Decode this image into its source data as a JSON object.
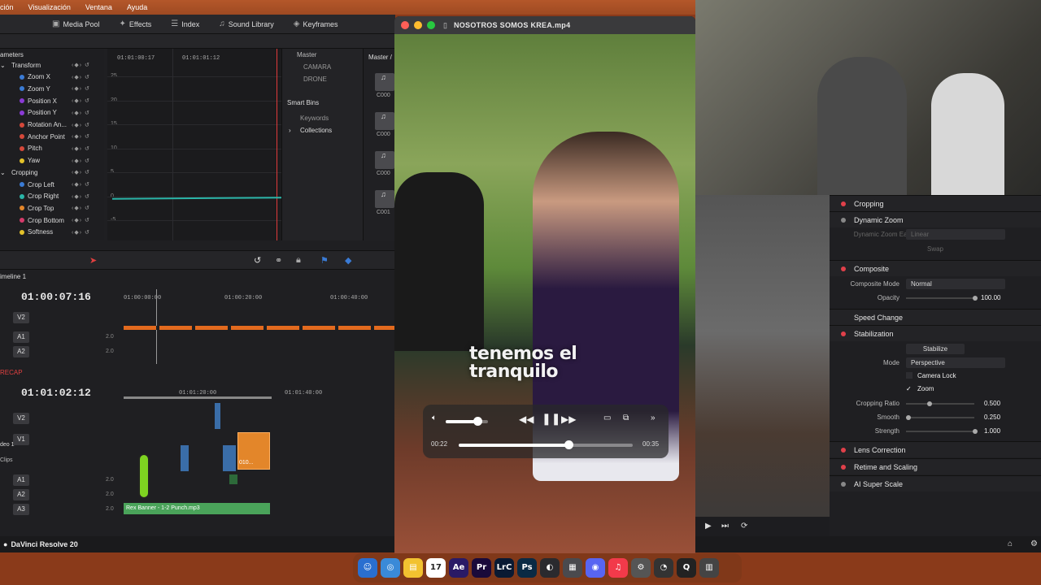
{
  "menubar": {
    "items": [
      "ción",
      "Visualización",
      "Ventana",
      "Ayuda"
    ]
  },
  "toolbar": {
    "media_pool": "Media Pool",
    "effects": "Effects",
    "index": "Index",
    "sound_library": "Sound Library",
    "keyframes": "Keyframes"
  },
  "keyframes": {
    "header": "ameters",
    "master_label": "Master",
    "params": [
      {
        "label": "Transform",
        "color": "#c0c0c0",
        "group": true
      },
      {
        "label": "Zoom X",
        "color": "#3a7bd5"
      },
      {
        "label": "Zoom Y",
        "color": "#3a7bd5"
      },
      {
        "label": "Position X",
        "color": "#8a3ad5"
      },
      {
        "label": "Position Y",
        "color": "#8a3ad5"
      },
      {
        "label": "Rotation An...",
        "color": "#d5483a"
      },
      {
        "label": "Anchor Point",
        "color": "#d5483a"
      },
      {
        "label": "Pitch",
        "color": "#d5483a"
      },
      {
        "label": "Yaw",
        "color": "#e3c22a"
      },
      {
        "label": "Cropping",
        "color": "#c0c0c0",
        "group": true
      },
      {
        "label": "Crop Left",
        "color": "#3a7bd5"
      },
      {
        "label": "Crop Right",
        "color": "#2ab5a8"
      },
      {
        "label": "Crop Top",
        "color": "#e3862a"
      },
      {
        "label": "Crop Bottom",
        "color": "#d53a6a"
      },
      {
        "label": "Softness",
        "color": "#e3c22a"
      }
    ],
    "y_ticks": [
      "25",
      "20",
      "15",
      "10",
      "5",
      "0",
      "-5"
    ],
    "ruler": [
      "01:01:00:17",
      "01:01:01:12"
    ]
  },
  "bins": {
    "master": "Master",
    "items": [
      "CAMARA",
      "DRONE"
    ],
    "smart_bins": "Smart Bins",
    "keywords": "Keywords",
    "collections": "Collections",
    "master_col": "Master /",
    "clip_ids": [
      "C000",
      "C000",
      "C000",
      "C001"
    ]
  },
  "timeline1": {
    "name": "imeline 1",
    "timecode": "01:00:07:16",
    "ruler": [
      "01:00:00:00",
      "01:00:20:00",
      "01:00:40:00"
    ],
    "tracks": [
      {
        "label": "V2",
        "vol": ""
      },
      {
        "label": "A1",
        "vol": "2.0"
      },
      {
        "label": "A2",
        "vol": "2.0"
      }
    ]
  },
  "timeline2": {
    "name": "RECAP",
    "timecode": "01:01:02:12",
    "ruler": [
      "01:01:20:00",
      "01:01:40:00"
    ],
    "tracks": [
      {
        "label": "V2",
        "vol": ""
      },
      {
        "label": "V1",
        "vol": ""
      },
      {
        "label": "A1",
        "vol": "2.0"
      },
      {
        "label": "A2",
        "vol": "2.0"
      },
      {
        "label": "A3",
        "vol": "2.0"
      }
    ],
    "video_label": "deo 1",
    "clips_label": "Clips",
    "audio_clip": "Rex Banner - 1-2 Punch.mp3",
    "orange_clip_text": "010..."
  },
  "player": {
    "title": "NOSOTROS SOMOS KREA.mp4",
    "caption_line1": "tenemos el",
    "caption_line2": "tranquilo",
    "time_elapsed": "00:22",
    "time_remaining": "00:35",
    "progress": 0.63,
    "volume": 0.75
  },
  "inspector": {
    "cropping": "Cropping",
    "dynamic_zoom": "Dynamic Zoom",
    "dynamic_zoom_ease_label": "Dynamic Zoom Ease",
    "dynamic_zoom_ease_value": "Linear",
    "swap": "Swap",
    "composite": "Composite",
    "composite_mode_label": "Composite Mode",
    "composite_mode_value": "Normal",
    "opacity_label": "Opacity",
    "opacity_value": "100.00",
    "speed_change": "Speed Change",
    "stabilization": "Stabilization",
    "stabilize": "Stabilize",
    "mode_label": "Mode",
    "mode_value": "Perspective",
    "camera_lock": "Camera Lock",
    "zoom": "Zoom",
    "cropping_ratio_label": "Cropping Ratio",
    "cropping_ratio_value": "0.500",
    "smooth_label": "Smooth",
    "smooth_value": "0.250",
    "strength_label": "Strength",
    "strength_value": "1.000",
    "lens_correction": "Lens Correction",
    "retime_scaling": "Retime and Scaling",
    "ai_super_scale": "AI Super Scale"
  },
  "appbar": {
    "title": "DaVinci Resolve 20"
  },
  "dock": {
    "apps": [
      "Finder",
      "Safari",
      "Notes",
      "17",
      "Ae",
      "Pr",
      "LrC",
      "Ps",
      "Resolve",
      "Preview",
      "Discord",
      "Music",
      "Utility",
      "Clock",
      "Q",
      "Trash"
    ]
  }
}
